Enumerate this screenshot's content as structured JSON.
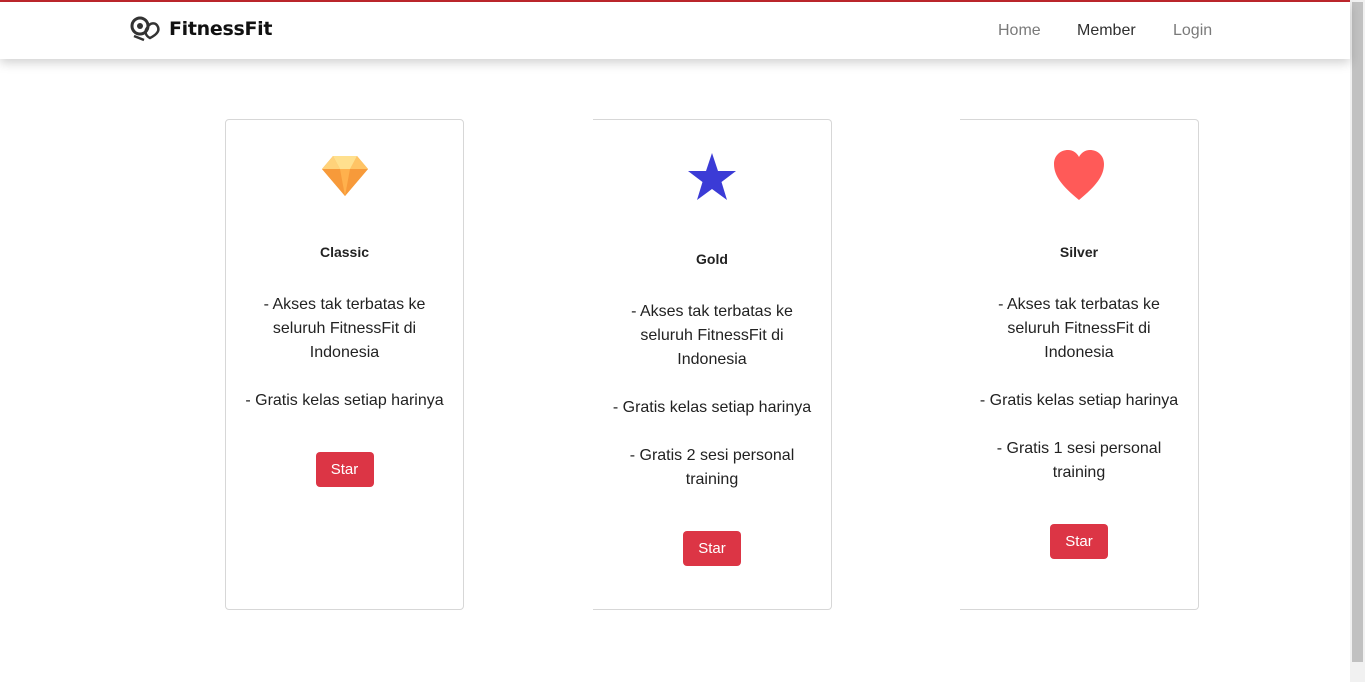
{
  "brand": {
    "name": "FitnessFit",
    "logo_icon": "dumbbell-heart-icon"
  },
  "nav": {
    "items": [
      {
        "label": "Home",
        "active": false
      },
      {
        "label": "Member",
        "active": true
      },
      {
        "label": "Login",
        "active": false
      }
    ]
  },
  "colors": {
    "accent": "#dc3545",
    "topline": "#c0272d",
    "diamond": "#f7a94a",
    "star": "#3b3bd6",
    "heart": "#ff5a58"
  },
  "plans": [
    {
      "icon": "diamond-icon",
      "title": "Classic",
      "features": [
        "- Akses tak terbatas ke seluruh FitnessFit di Indonesia",
        "- Gratis kelas setiap harinya"
      ],
      "button": "Star"
    },
    {
      "icon": "star-icon",
      "title": "Gold",
      "features": [
        "- Akses tak terbatas ke seluruh FitnessFit di Indonesia",
        "- Gratis kelas setiap harinya",
        "- Gratis 2 sesi personal training"
      ],
      "button": "Star"
    },
    {
      "icon": "heart-icon",
      "title": "Silver",
      "features": [
        "- Akses tak terbatas ke seluruh FitnessFit di Indonesia",
        "- Gratis kelas setiap harinya",
        "- Gratis 1 sesi personal training"
      ],
      "button": "Star"
    }
  ]
}
